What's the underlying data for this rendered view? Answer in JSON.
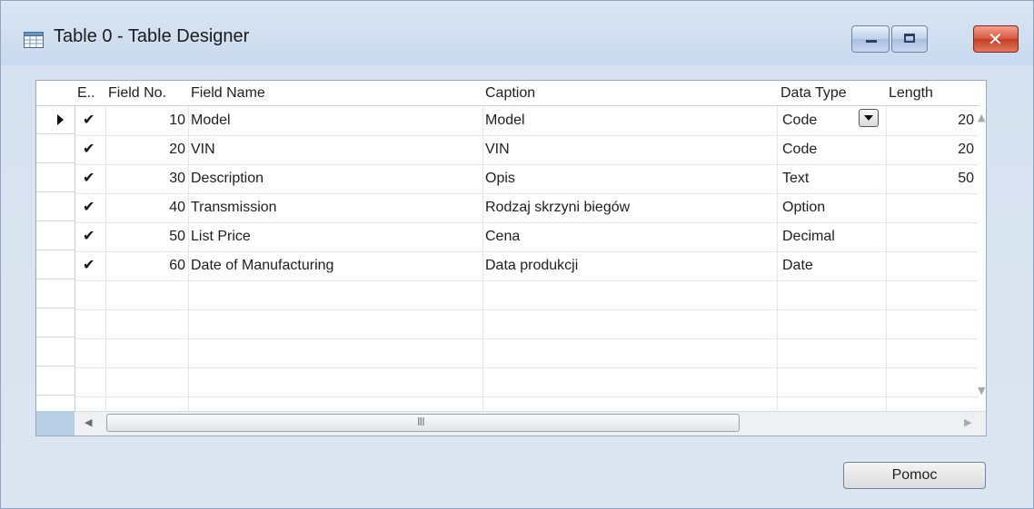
{
  "window": {
    "title": "Table 0 - Table Designer",
    "icons": [
      "table-icon",
      "minimize-icon",
      "maximize-icon",
      "close-icon"
    ],
    "close_glyph": "✕"
  },
  "grid": {
    "columns": [
      "E..",
      "Field No.",
      "Field Name",
      "Caption",
      "Data Type",
      "Length"
    ],
    "rows": [
      {
        "enabled": "✔",
        "field_no": "10",
        "field_name": "Model",
        "caption": "Model",
        "data_type": "Code",
        "length": "20"
      },
      {
        "enabled": "✔",
        "field_no": "20",
        "field_name": "VIN",
        "caption": "VIN",
        "data_type": "Code",
        "length": "20"
      },
      {
        "enabled": "✔",
        "field_no": "30",
        "field_name": "Description",
        "caption": "Opis",
        "data_type": "Text",
        "length": "50"
      },
      {
        "enabled": "✔",
        "field_no": "40",
        "field_name": "Transmission",
        "caption": "Rodzaj skrzyni biegów",
        "data_type": "Option",
        "length": ""
      },
      {
        "enabled": "✔",
        "field_no": "50",
        "field_name": "List Price",
        "caption": "Cena",
        "data_type": "Decimal",
        "length": ""
      },
      {
        "enabled": "✔",
        "field_no": "60",
        "field_name": "Date of Manufacturing",
        "caption": "Data produkcji",
        "data_type": "Date",
        "length": ""
      }
    ],
    "scroll_grip": "III"
  },
  "buttons": {
    "help_label": "Pomoc"
  }
}
